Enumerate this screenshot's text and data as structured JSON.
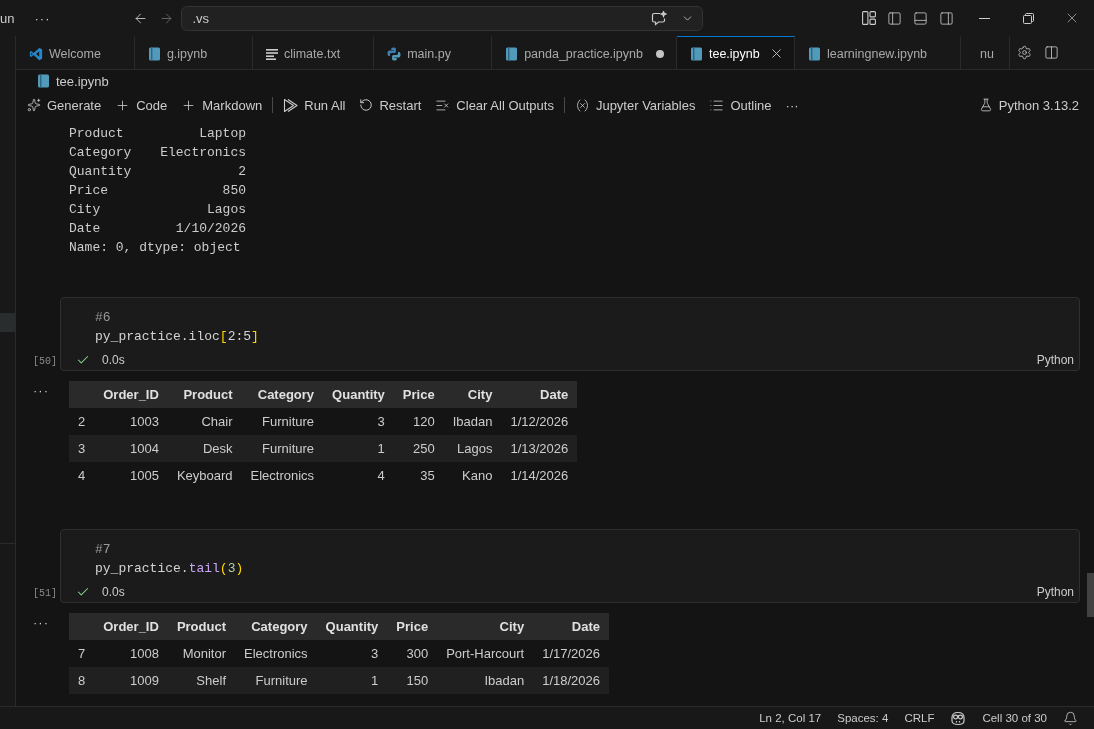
{
  "title_bar": {
    "menu": "un",
    "more": "···",
    "search": {
      "value": ".vs"
    }
  },
  "tabs": [
    {
      "label": "Welcome",
      "kind": "welcome",
      "selected": false,
      "modified": false
    },
    {
      "label": "g.ipynb",
      "kind": "notebook",
      "selected": false,
      "modified": false
    },
    {
      "label": "climate.txt",
      "kind": "text",
      "selected": false,
      "modified": false
    },
    {
      "label": "main.py",
      "kind": "python",
      "selected": false,
      "modified": false
    },
    {
      "label": "panda_practice.ipynb",
      "kind": "notebook",
      "selected": false,
      "modified": true
    },
    {
      "label": "tee.ipynb",
      "kind": "notebook",
      "selected": true,
      "modified": false
    },
    {
      "label": "learningnew.ipynb",
      "kind": "notebook",
      "selected": false,
      "modified": false
    },
    {
      "label": "nu",
      "kind": "notebook",
      "selected": false,
      "modified": false
    }
  ],
  "breadcrumb": {
    "label": "tee.ipynb"
  },
  "toolbar": {
    "items": [
      {
        "kind": "generate",
        "label": "Generate"
      },
      {
        "kind": "add",
        "label": "Code"
      },
      {
        "kind": "add",
        "label": "Markdown"
      },
      {
        "kind": "separator"
      },
      {
        "kind": "run-all",
        "label": "Run All"
      },
      {
        "kind": "restart",
        "label": "Restart"
      },
      {
        "kind": "clear",
        "label": "Clear All Outputs"
      },
      {
        "kind": "separator"
      },
      {
        "kind": "variables",
        "label": "Jupyter Variables"
      },
      {
        "kind": "outline",
        "label": "Outline"
      },
      {
        "kind": "more",
        "label": "···"
      }
    ],
    "kernel": "Python 3.13.2"
  },
  "series_output": {
    "rows": [
      {
        "label": "Product",
        "value": "Laptop"
      },
      {
        "label": "Category",
        "value": "Electronics"
      },
      {
        "label": "Quantity",
        "value": "2"
      },
      {
        "label": "Price",
        "value": "850"
      },
      {
        "label": "City",
        "value": "Lagos"
      },
      {
        "label": "Date",
        "value": "1/10/2026"
      }
    ],
    "footer": "Name: 0, dtype: object"
  },
  "cells": [
    {
      "comment": "#6",
      "code": [
        {
          "text": "py_practice.iloc",
          "kind": "plain"
        },
        {
          "text": "[",
          "kind": "bracket"
        },
        {
          "text": "2:5",
          "kind": "plain"
        },
        {
          "text": "]",
          "kind": "bracket"
        }
      ],
      "count": "[50]",
      "succeeded": true,
      "duration": "0.0s",
      "language": "Python",
      "output": {
        "more": "···",
        "columns": [
          "Order_ID",
          "Product",
          "Category",
          "Quantity",
          "Price",
          "City",
          "Date"
        ],
        "rows": [
          {
            "index": "2",
            "values": [
              "1003",
              "Chair",
              "Furniture",
              "3",
              "120",
              "Ibadan",
              "1/12/2026"
            ]
          },
          {
            "index": "3",
            "values": [
              "1004",
              "Desk",
              "Furniture",
              "1",
              "250",
              "Lagos",
              "1/13/2026"
            ]
          },
          {
            "index": "4",
            "values": [
              "1005",
              "Keyboard",
              "Electronics",
              "4",
              "35",
              "Kano",
              "1/14/2026"
            ]
          }
        ]
      }
    },
    {
      "comment": "#7",
      "code": [
        {
          "text": "py_practice.",
          "kind": "plain"
        },
        {
          "text": "tail",
          "kind": "method"
        },
        {
          "text": "(",
          "kind": "bracket"
        },
        {
          "text": "3",
          "kind": "number"
        },
        {
          "text": ")",
          "kind": "bracket"
        }
      ],
      "count": "[51]",
      "succeeded": true,
      "duration": "0.0s",
      "language": "Python",
      "output": {
        "more": "···",
        "columns": [
          "Order_ID",
          "Product",
          "Category",
          "Quantity",
          "Price",
          "City",
          "Date"
        ],
        "rows": [
          {
            "index": "7",
            "values": [
              "1008",
              "Monitor",
              "Electronics",
              "3",
              "300",
              "Port-Harcourt",
              "1/17/2026"
            ]
          },
          {
            "index": "8",
            "values": [
              "1009",
              "Shelf",
              "Furniture",
              "1",
              "150",
              "Ibadan",
              "1/18/2026"
            ]
          }
        ]
      }
    }
  ],
  "status_bar": {
    "items": [
      {
        "kind": "text",
        "label": "Ln 2, Col 17"
      },
      {
        "kind": "text",
        "label": "Spaces: 4"
      },
      {
        "kind": "text",
        "label": "CRLF"
      },
      {
        "kind": "assistant"
      },
      {
        "kind": "text",
        "label": "Cell 30 of 30"
      },
      {
        "kind": "bell"
      }
    ]
  }
}
